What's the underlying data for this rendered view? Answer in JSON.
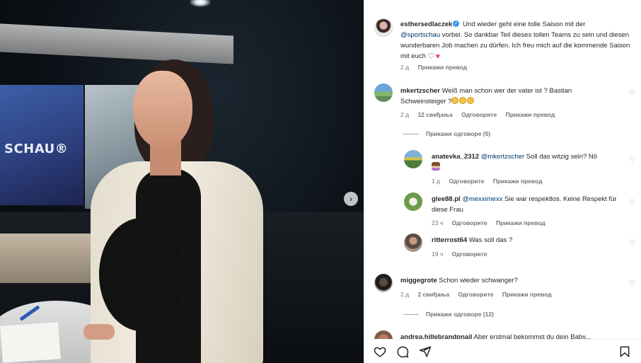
{
  "caption": {
    "username": "esthersedlaczek",
    "text_part1": "Und wieder geht eine tolle Saison mit der",
    "mention": "@sportschau",
    "text_part2": "vorbei. So dankbar Teil dieses tollen Teams zu sein und diesen wunderbaren Job machen zu dürfen. Ich freu mich auf die kommende Saison mit euch",
    "time": "2 д",
    "translate": "Прикажи превод"
  },
  "photo": {
    "screen_text": "SCHAU®"
  },
  "comments": [
    {
      "username": "mkertzscher",
      "text": "Weiß man schon wer der vater ist ? Bastian Schweinsteiger ?",
      "time": "2 д",
      "likes": "12 свиђања",
      "reply": "Одговорите",
      "translate": "Прикажи превод",
      "show_replies": "Прикажи одговоре (5)",
      "replies": [
        {
          "username": "anatevka_2312",
          "mention": "@mkertzscher",
          "text": "Soll das witzig sein? Nö",
          "time": "1 д",
          "reply": "Одговорите",
          "translate": "Прикажи превод"
        },
        {
          "username": "glee88.pl",
          "mention": "@mexximexx",
          "text": "Sie war respektlos. Keine Respekt für diese Frau",
          "time": "23 ч",
          "reply": "Одговорите",
          "translate": "Прикажи превод"
        },
        {
          "username": "ritterrost64",
          "text": "Was soll das ?",
          "time": "19 ч",
          "reply": "Одговорите"
        }
      ]
    },
    {
      "username": "miggegrote",
      "text": "Schon wieder schwanger?",
      "time": "2 д",
      "likes": "2 свиђања",
      "reply": "Одговорите",
      "translate": "Прикажи превод",
      "show_replies": "Прикажи одговоре (12)"
    },
    {
      "username": "andrea.hillebrandpnail",
      "text": "Aber erstmal bekommst du dein Baby..."
    }
  ],
  "colors": {
    "verified": "#3897f0",
    "mention": "#00376b",
    "heart": "#ed4956",
    "meta": "#737373"
  },
  "icons": [
    "verified-icon",
    "heart-icon",
    "comment-icon",
    "share-icon",
    "bookmark-icon",
    "next-arrow-icon"
  ]
}
